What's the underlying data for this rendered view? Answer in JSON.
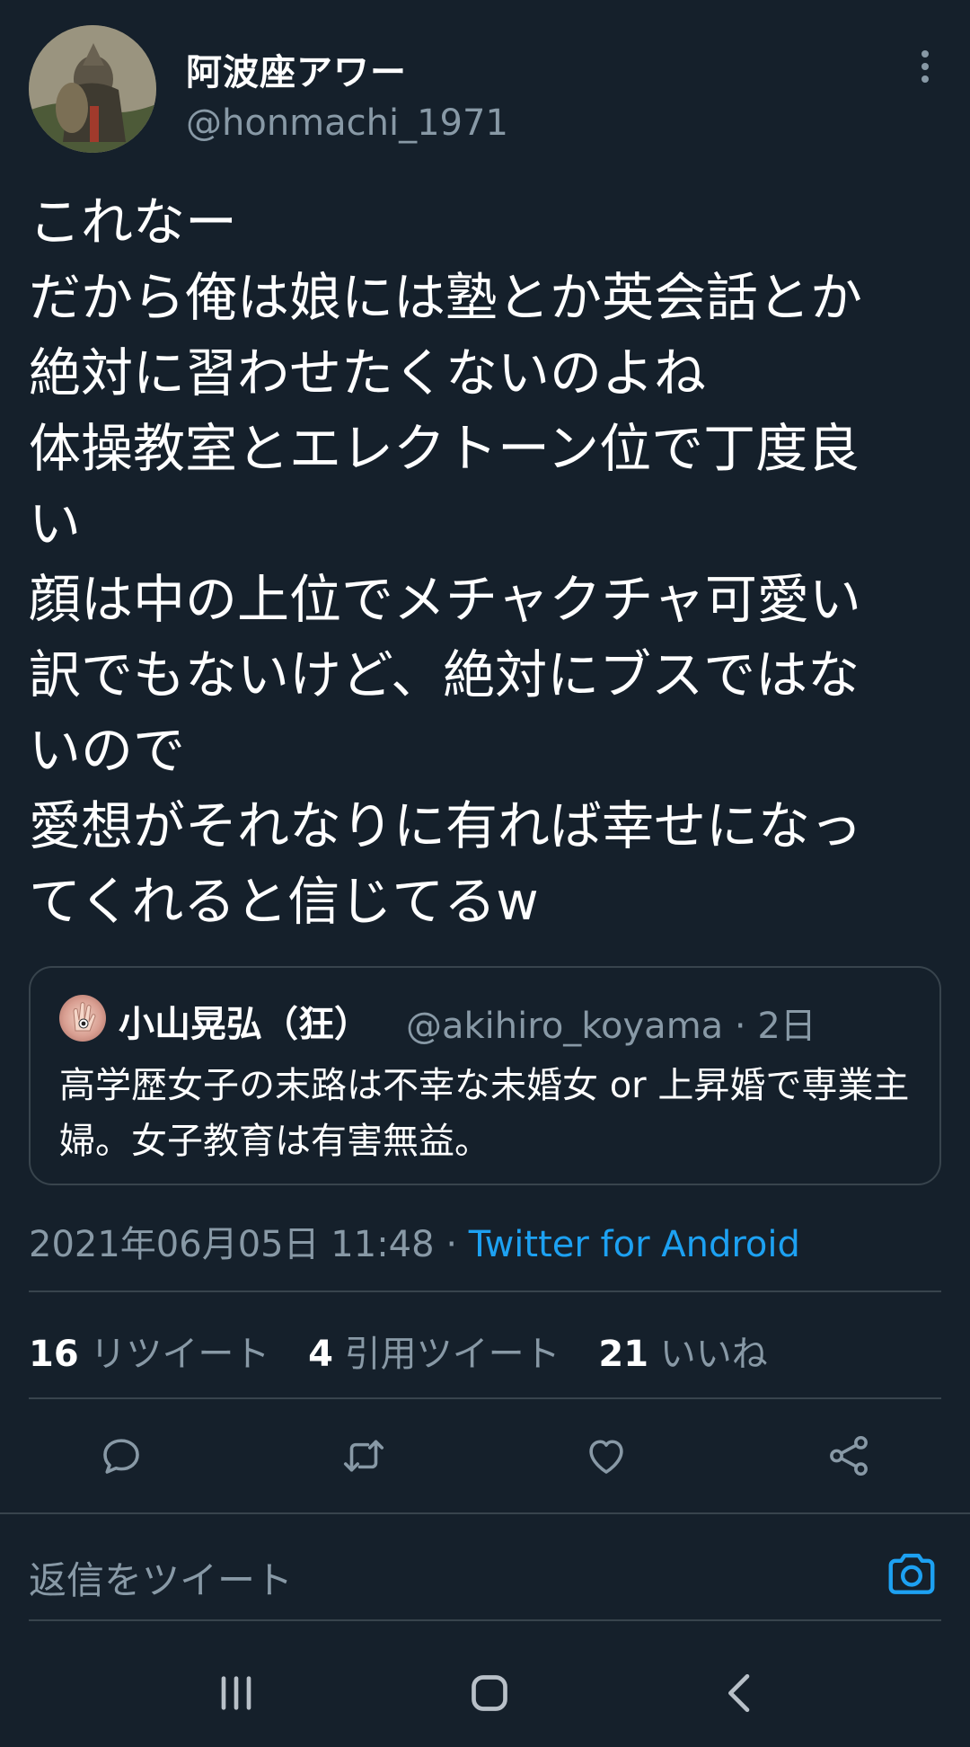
{
  "author": {
    "display_name": "阿波座アワー",
    "handle": "@honmachi_1971"
  },
  "tweet": {
    "lines": [
      "これなー",
      "だから俺は娘には塾とか英会話とか",
      "絶対に習わせたくないのよね",
      "体操教室とエレクトーン位で丁度良",
      "い",
      "顔は中の上位でメチャクチャ可愛い",
      "訳でもないけど、絶対にブスではな",
      "いので",
      "愛想がそれなりに有れば幸せになっ",
      "てくれると信じてるw"
    ]
  },
  "quote": {
    "name": "小山晃弘（狂）",
    "handle": "@akihiro_koyama",
    "separator": "·",
    "time": "2日",
    "text": "高学歴女子の末路は不幸な未婚女 or 上昇婚で専業主婦。女子教育は有害無益。"
  },
  "meta": {
    "date": "2021年06月05日 11:48",
    "separator": "·",
    "source": "Twitter for Android"
  },
  "stats": {
    "retweets": {
      "count": "16",
      "label": "リツイート"
    },
    "quotes": {
      "count": "4",
      "label": "引用ツイート"
    },
    "likes": {
      "count": "21",
      "label": "いいね"
    }
  },
  "reply": {
    "placeholder": "返信をツイート"
  },
  "icons": {
    "reply": "reply-icon",
    "retweet": "retweet-icon",
    "like": "heart-icon",
    "share": "share-icon",
    "camera": "camera-icon",
    "more": "more-vertical-icon"
  },
  "colors": {
    "background": "#15202b",
    "secondary_text": "#8899a6",
    "accent": "#1da1f2",
    "border": "#38444d"
  }
}
